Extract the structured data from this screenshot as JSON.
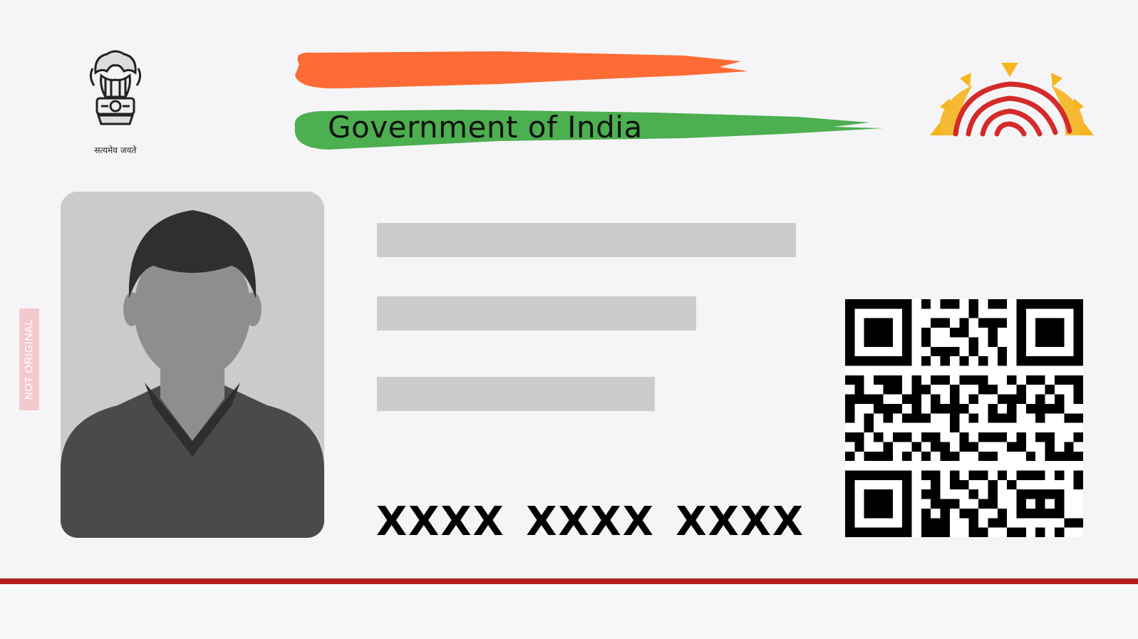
{
  "card": {
    "emblem": {
      "icon": "state-emblem-icon",
      "motto": "सत्यमेव जयते"
    },
    "header": {
      "title": "Government of India"
    },
    "logo": {
      "icon": "aadhaar-fingerprint-sun-icon"
    },
    "photo": {
      "icon": "person-placeholder-icon"
    },
    "watermark": "NOT ORIGINAL",
    "aadhaar_number": "XXXX XXXX XXXX",
    "qr": {
      "icon": "qr-code-icon"
    }
  },
  "colors": {
    "saffron": "#ff6b35",
    "green": "#4caf50",
    "logo_red": "#d42a2a",
    "logo_yellow": "#f6b51e",
    "accent_line": "#b21b1b",
    "placeholder_bar": "#cccccc"
  }
}
